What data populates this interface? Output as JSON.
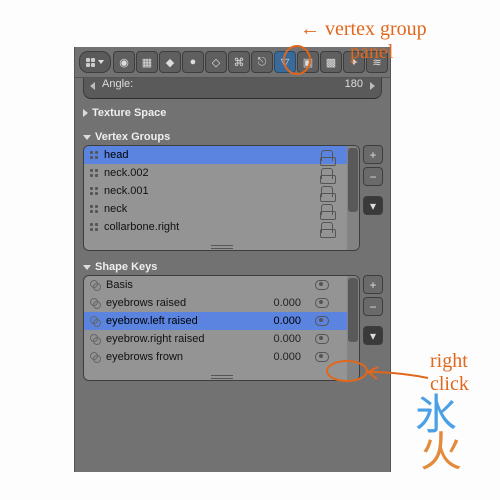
{
  "header": {
    "left_pill": "editor-type-selector",
    "tabs": [
      {
        "name": "render-icon",
        "active": false
      },
      {
        "name": "layers-icon",
        "active": false
      },
      {
        "name": "scene-icon",
        "active": false
      },
      {
        "name": "world-icon",
        "active": false
      },
      {
        "name": "object-icon",
        "active": false
      },
      {
        "name": "constraints-icon",
        "active": false
      },
      {
        "name": "modifiers-icon",
        "active": false
      },
      {
        "name": "vertex-groups-icon",
        "active": true
      },
      {
        "name": "materials-icon",
        "active": false
      },
      {
        "name": "textures-icon",
        "active": false
      },
      {
        "name": "particles-icon",
        "active": false
      },
      {
        "name": "physics-icon",
        "active": false
      }
    ]
  },
  "numslice": {
    "label": "Angle:",
    "value": "180"
  },
  "sections": {
    "texture_space": {
      "title": "Texture Space",
      "open": false
    },
    "vertex_groups": {
      "title": "Vertex Groups",
      "open": true,
      "items": [
        {
          "name": "head",
          "selected": true
        },
        {
          "name": "neck.002",
          "selected": false
        },
        {
          "name": "neck.001",
          "selected": false
        },
        {
          "name": "neck",
          "selected": false
        },
        {
          "name": "collarbone.right",
          "selected": false
        }
      ]
    },
    "shape_keys": {
      "title": "Shape Keys",
      "open": true,
      "items": [
        {
          "name": "Basis",
          "value": "",
          "selected": false
        },
        {
          "name": "eyebrows raised",
          "value": "0.000",
          "selected": false
        },
        {
          "name": "eyebrow.left raised",
          "value": "0.000",
          "selected": true
        },
        {
          "name": "eyebrow.right raised",
          "value": "0.000",
          "selected": false
        },
        {
          "name": "eyebrows frown",
          "value": "0.000",
          "selected": false
        }
      ]
    }
  },
  "controls": {
    "plus": "+",
    "minus": "−",
    "menu": "▾"
  },
  "annotations": {
    "top": "← vertex group\n          panel",
    "right": "right\nclick"
  },
  "glyphs": {
    "ice": "氷",
    "fire": "火"
  }
}
